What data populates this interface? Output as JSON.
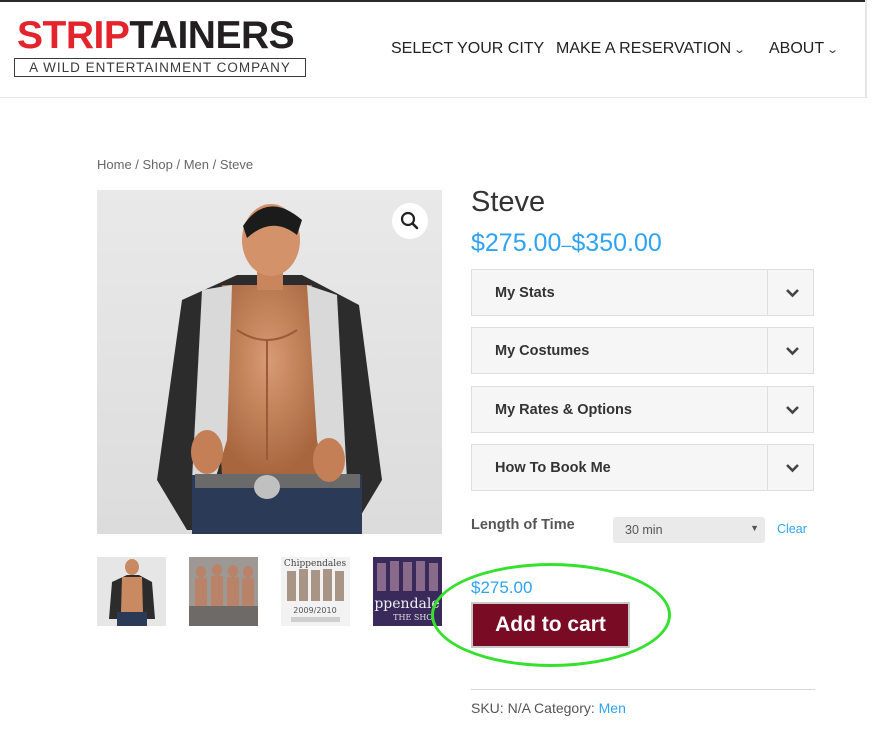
{
  "brand": {
    "name_red": "STRIP",
    "name_dark": "TAINERS",
    "tagline": "A WILD ENTERTAINMENT COMPANY",
    "red": "#e4242c"
  },
  "nav": {
    "items": [
      {
        "label": "SELECT YOUR CITY",
        "has_dropdown": false
      },
      {
        "label": "MAKE A RESERVATION",
        "has_dropdown": true
      },
      {
        "label": "ABOUT",
        "has_dropdown": true
      }
    ],
    "chevron": "⌄"
  },
  "breadcrumb": "Home / Shop / Men / Steve",
  "product": {
    "title": "Steve",
    "price_min": "$275.00",
    "price_sep": "–",
    "price_max": "$350.00",
    "accordion": [
      {
        "label": "My Stats"
      },
      {
        "label": "My Costumes"
      },
      {
        "label": "My Rates & Options"
      },
      {
        "label": "How To Book Me"
      }
    ],
    "variation": {
      "label": "Length of Time",
      "selected": "30 min",
      "clear_label": "Clear"
    },
    "current_price": "$275.00",
    "add_to_cart_label": "Add to cart",
    "sku_label": "SKU:",
    "sku_value": "N/A",
    "category_label": "Category:",
    "category_value": "Men"
  },
  "gallery": {
    "thumbnails": [
      {
        "icon": "photo-steve-icon"
      },
      {
        "icon": "photo-group-icon"
      },
      {
        "icon": "photo-poster-icon",
        "text_top": "Chippendales",
        "text_mid": "2009/2010"
      },
      {
        "icon": "photo-show-icon",
        "text_top": "ppendale",
        "text_bot": "THE SHO"
      }
    ]
  },
  "colors": {
    "link": "#2ea3f2",
    "button": "#7a0b24",
    "highlight": "#35e02e"
  }
}
